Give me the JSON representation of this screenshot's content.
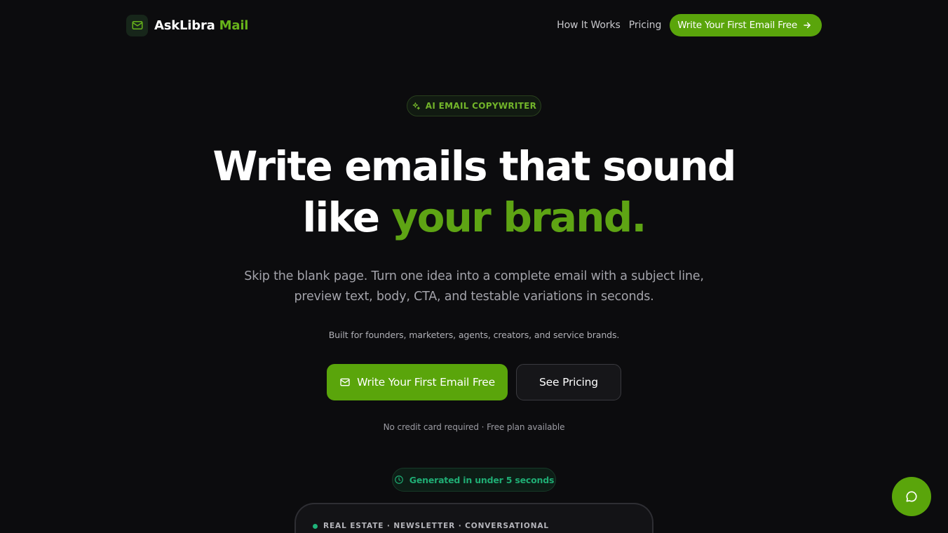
{
  "header": {
    "brand_name": "AskLibra",
    "brand_accent": "Mail",
    "nav": {
      "how_it_works": "How It Works",
      "pricing": "Pricing",
      "cta": "Write Your First Email Free"
    }
  },
  "hero": {
    "badge": "AI EMAIL COPYWRITER",
    "headline_line1": "Write emails that sound",
    "headline_line2_plain": "like ",
    "headline_line2_accent": "your brand.",
    "subtitle_line1": "Skip the blank page. Turn one idea into a complete email with a subject line,",
    "subtitle_line2": "preview text, body, CTA, and testable variations in seconds.",
    "audience": "Built for founders, marketers, agents, creators, and service brands.",
    "primary_cta": "Write Your First Email Free",
    "secondary_cta": "See Pricing",
    "fine_print": "No credit card required · Free plan available"
  },
  "preview": {
    "speed_badge": "Generated in under 5 seconds",
    "tag": "REAL ESTATE · NEWSLETTER · CONVERSATIONAL"
  },
  "icons": {
    "brand": "mail-icon",
    "badge": "sparkles-icon",
    "nav_cta": "arrow-right-icon",
    "primary_cta": "mail-icon",
    "speed": "clock-icon",
    "chat": "chat-bubble-icon"
  },
  "colors": {
    "background": "#0c0c0e",
    "accent": "#5aa50b",
    "accent_text": "#67b31a",
    "teal": "#1fad74"
  }
}
